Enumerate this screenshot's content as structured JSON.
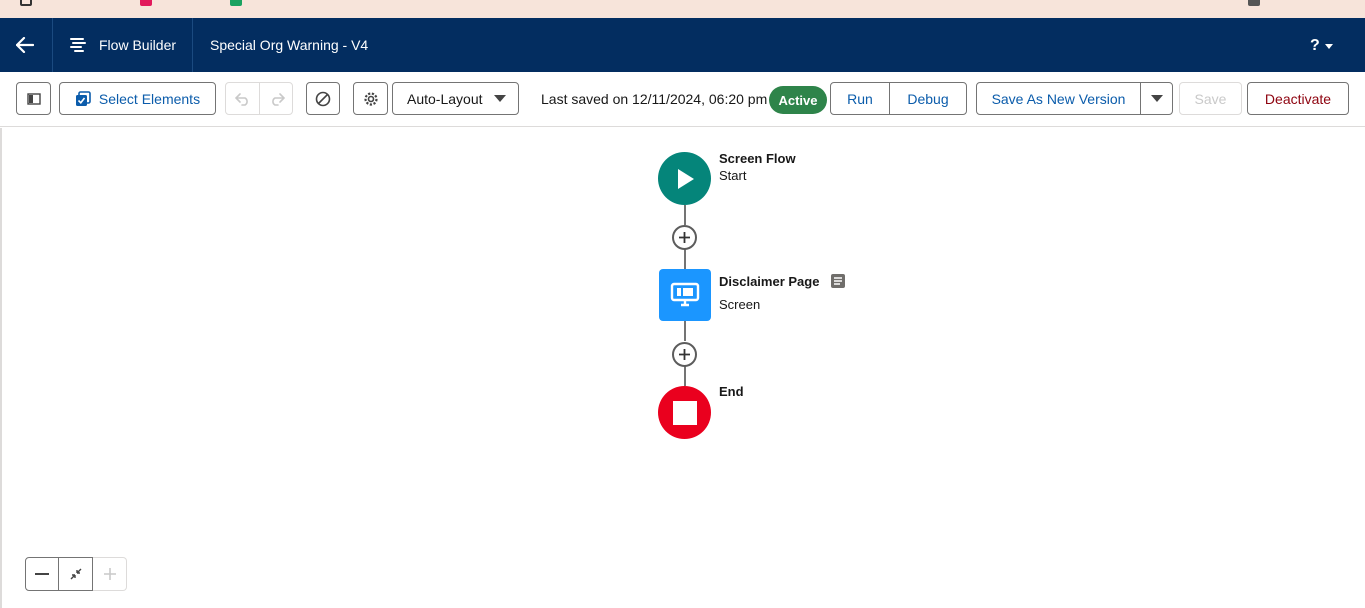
{
  "header": {
    "app_name": "Flow Builder",
    "flow_title": "Special Org Warning - V4",
    "help_label": "?"
  },
  "toolbar": {
    "select_elements_label": "Select Elements",
    "layout_select_value": "Auto-Layout",
    "last_saved": "Last saved on 12/11/2024, 06:20 pm",
    "status": "Active",
    "run_label": "Run",
    "debug_label": "Debug",
    "save_as_new_version_label": "Save As New Version",
    "save_label": "Save",
    "deactivate_label": "Deactivate"
  },
  "canvas": {
    "start": {
      "title": "Screen Flow",
      "subtitle": "Start"
    },
    "screen": {
      "title": "Disclaimer Page",
      "subtitle": "Screen"
    },
    "end": {
      "title": "End"
    }
  },
  "colors": {
    "header_bg": "#032d60",
    "start_node": "#05857a",
    "screen_node": "#1b96ff",
    "end_node": "#ea001e",
    "active_badge": "#2e844a"
  }
}
